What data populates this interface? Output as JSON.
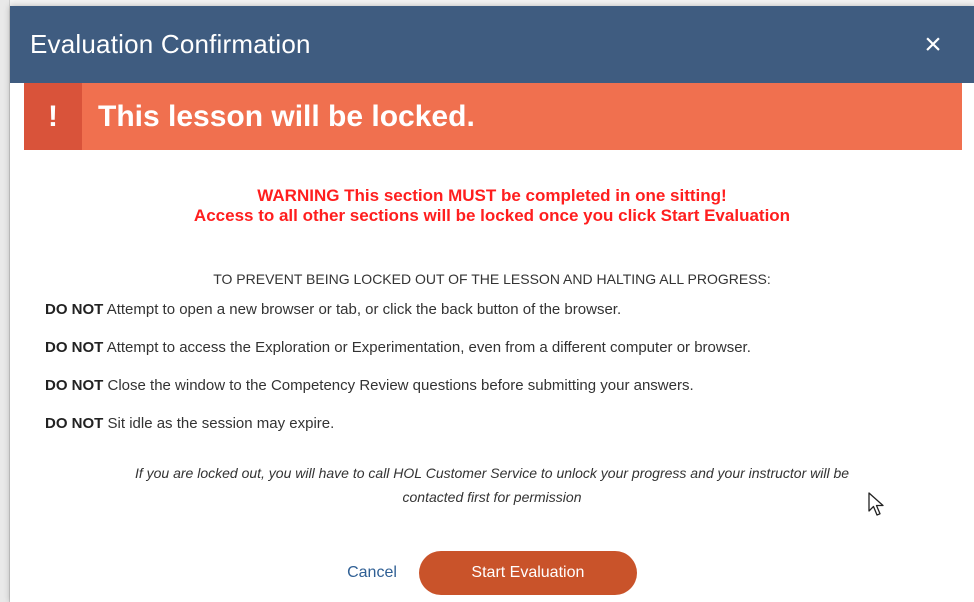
{
  "dialog": {
    "title": "Evaluation Confirmation",
    "close_icon": "×"
  },
  "banner": {
    "icon": "!",
    "text": "This lesson will be locked."
  },
  "warning": {
    "line1": "WARNING This section MUST be completed in one sitting!",
    "line2": "Access to all other sections will be locked once you click Start Evaluation"
  },
  "prevent_heading": "TO PREVENT BEING LOCKED OUT OF THE LESSON AND HALTING ALL PROGRESS:",
  "rules": [
    {
      "label": "DO NOT",
      "text": "Attempt to open a new browser or tab, or click the back button of the browser."
    },
    {
      "label": "DO NOT",
      "text": "Attempt to access the Exploration or Experimentation, even from a different computer or browser."
    },
    {
      "label": "DO NOT",
      "text": "Close the window to the Competency Review questions before submitting your answers."
    },
    {
      "label": "DO NOT",
      "text": "Sit idle as the session may expire."
    }
  ],
  "locked_note": {
    "line1": "If you are locked out, you will have to call HOL Customer Service to unlock your progress and your instructor will be",
    "line2": "contacted first for permission"
  },
  "footer": {
    "cancel_label": "Cancel",
    "start_label": "Start Evaluation"
  },
  "colors": {
    "header": "#3f5c80",
    "banner": "#f0704f",
    "banner_icon_bg": "#d9533a",
    "warning_text": "#ff1e1e",
    "start_button": "#c9532a",
    "cancel_link": "#2f5f94"
  }
}
